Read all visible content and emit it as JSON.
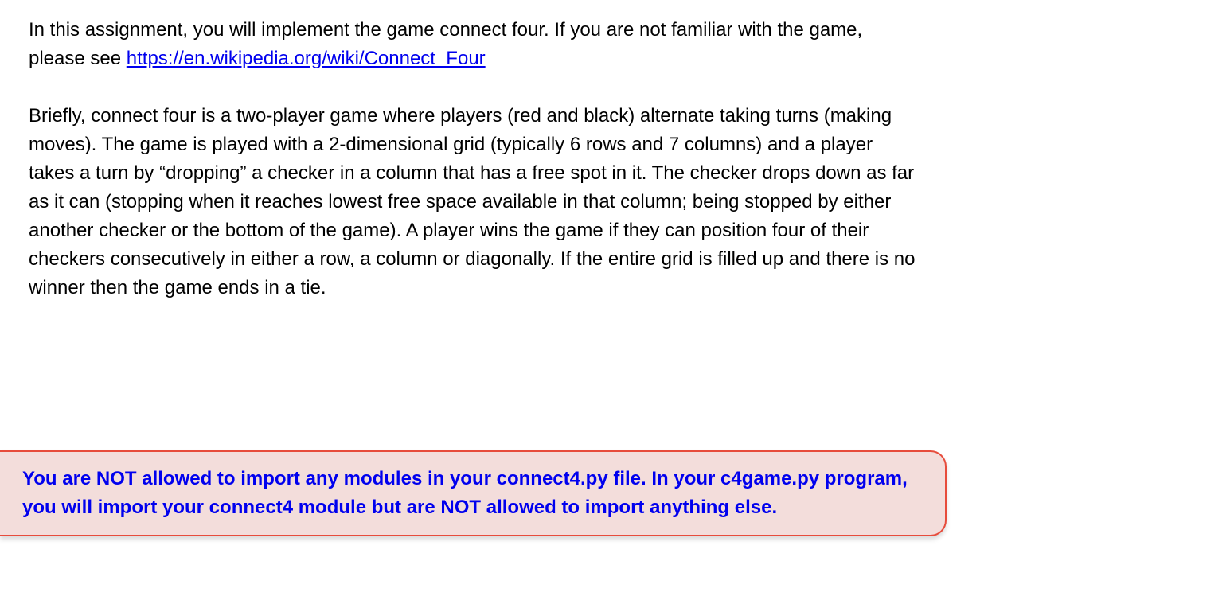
{
  "intro": {
    "part1": "In this assignment, you will implement the game connect four. If you are not familiar with the game, please see ",
    "link_text": "https://en.wikipedia.org/wiki/Connect_Four"
  },
  "description": "Briefly, connect four is a two-player game where players (red and black) alternate taking turns (making moves). The game is played with a 2-dimensional grid (typically 6 rows and 7 columns) and a player takes a turn by “dropping” a checker in a column that has a free spot in it. The checker drops down as far as it can (stopping when it reaches lowest free space available in that column; being stopped by either another checker or the bottom of the game). A player wins the game if they can position four of their checkers consecutively in either a row, a column or diagonally. If the entire grid is filled up and there is no winner then the game ends in a tie.",
  "warning": "You are NOT allowed to import any modules in your connect4.py file. In your c4game.py program, you will import your connect4 module but are NOT allowed to import anything else."
}
